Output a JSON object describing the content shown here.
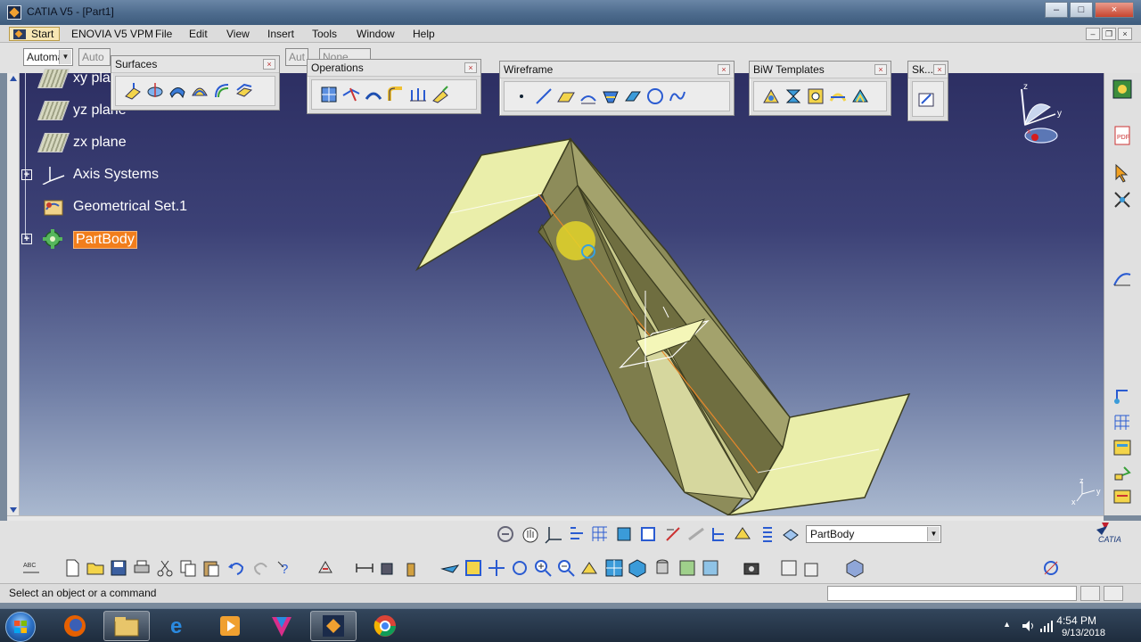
{
  "window": {
    "title": "CATIA V5 - [Part1]",
    "controls": [
      "–",
      "□",
      "×"
    ]
  },
  "menu": {
    "start": "Start",
    "items": [
      "ENOVIA V5 VPM",
      "File",
      "Edit",
      "View",
      "Insert",
      "Tools",
      "Window",
      "Help"
    ]
  },
  "top_toolbar": {
    "combo_1": "Automa",
    "combo_2": "Auto",
    "combo_3": "Aut",
    "combo_4": "None"
  },
  "spec_tree": {
    "items": [
      {
        "label": "xy plane",
        "icon": "plane-icon"
      },
      {
        "label": "yz plane",
        "icon": "plane-icon"
      },
      {
        "label": "zx plane",
        "icon": "plane-icon"
      },
      {
        "label": "Axis Systems",
        "icon": "axis-icon"
      },
      {
        "label": "Geometrical Set.1",
        "icon": "geometrical-set-icon"
      },
      {
        "label": "PartBody",
        "icon": "part-body-icon",
        "selected": true
      }
    ]
  },
  "toolbars": {
    "surfaces": "Surfaces",
    "operations": "Operations",
    "wireframe": "Wireframe",
    "biw_templates": "BiW Templates",
    "sketcher": "Sk..."
  },
  "compass": {
    "z": "z",
    "y": "y",
    "x": "x"
  },
  "mini_axis": {
    "z": "z",
    "y": "y",
    "x": "x"
  },
  "bottom_toolbar": {
    "current_body": "PartBody",
    "abc_label": "ABC"
  },
  "catia_logo": "CATIA",
  "status_bar": {
    "message": "Select an object or a command"
  },
  "taskbar": {
    "time": "4:54 PM",
    "date": "9/13/2018"
  },
  "colors": {
    "selection": "#f27e1c",
    "part_face": "#eaeeaa",
    "viewport_top": "#2d2f63",
    "viewport_bottom": "#a9b8cf"
  }
}
